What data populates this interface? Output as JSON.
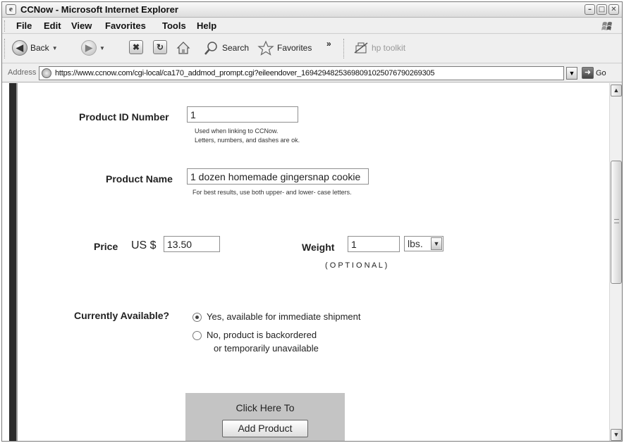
{
  "window": {
    "title": "CCNow - Microsoft Internet Explorer",
    "controls": [
      "minimize",
      "maximize",
      "close"
    ]
  },
  "menu": [
    "File",
    "Edit",
    "View",
    "Favorites",
    "Tools",
    "Help"
  ],
  "toolbar": {
    "back": "Back",
    "search": "Search",
    "favorites": "Favorites",
    "chevron": "»",
    "hp_toolkit": "hp toolkit"
  },
  "address": {
    "label": "Address",
    "url": "https://www.ccnow.com/cgi-local/ca170_addmod_prompt.cgi?eileendover_16942948253698091025076790269305",
    "go": "Go"
  },
  "form": {
    "product_id": {
      "label": "Product ID Number",
      "value": "1",
      "hint_line1": "Used when linking to CCNow.",
      "hint_line2": "Letters, numbers, and dashes are ok."
    },
    "product_name": {
      "label": "Product Name",
      "value": "1 dozen homemade gingersnap cookie",
      "hint": "For best results, use both upper- and lower- case letters."
    },
    "price": {
      "label": "Price",
      "currency": "US $",
      "value": "13.50"
    },
    "weight": {
      "label": "Weight",
      "value": "1",
      "unit": "lbs.",
      "optional": "( O P T I O N A L )"
    },
    "availability": {
      "label": "Currently Available?",
      "option_yes": "Yes, available for immediate shipment",
      "option_no_line1": "No, product is backordered",
      "option_no_line2": "or temporarily unavailable",
      "selected": "yes"
    },
    "submit": {
      "caption": "Click Here To",
      "button": "Add Product"
    }
  }
}
